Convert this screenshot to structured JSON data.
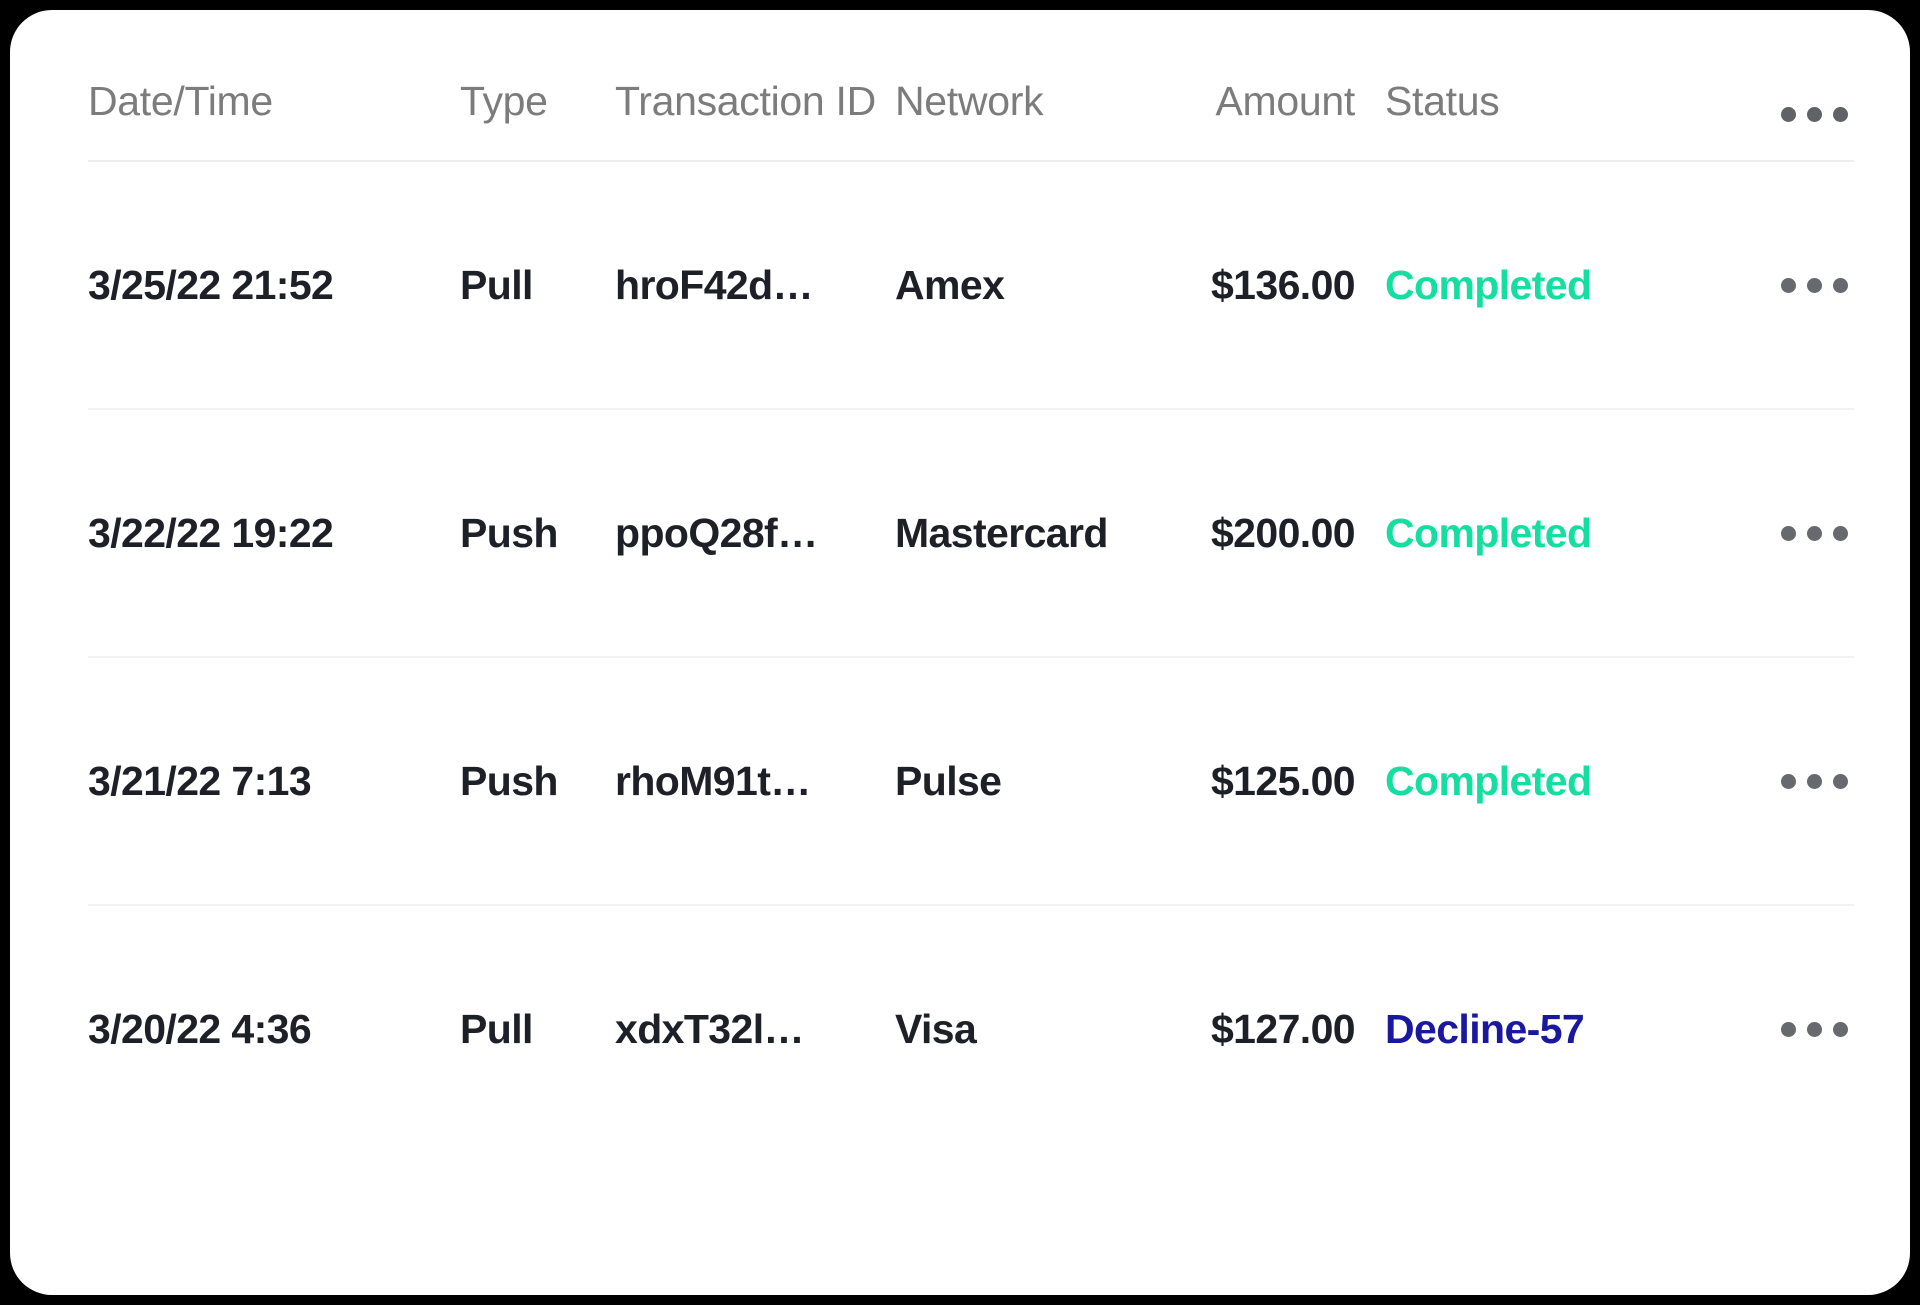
{
  "table": {
    "columns": [
      {
        "key": "datetime",
        "label": "Date/Time"
      },
      {
        "key": "type",
        "label": "Type"
      },
      {
        "key": "transaction_id",
        "label": "Transaction ID"
      },
      {
        "key": "network",
        "label": "Network"
      },
      {
        "key": "amount",
        "label": "Amount"
      },
      {
        "key": "status",
        "label": "Status"
      }
    ],
    "header_menu_icon": "ellipsis-icon",
    "row_menu_icon": "ellipsis-icon",
    "rows": [
      {
        "datetime": "3/25/22 21:52",
        "type": "Pull",
        "transaction_id": "hroF42d…",
        "network": "Amex",
        "amount": "$136.00",
        "status": "Completed",
        "status_state": "completed"
      },
      {
        "datetime": "3/22/22 19:22",
        "type": "Push",
        "transaction_id": "ppoQ28f…",
        "network": "Mastercard",
        "amount": "$200.00",
        "status": "Completed",
        "status_state": "completed"
      },
      {
        "datetime": "3/21/22 7:13",
        "type": "Push",
        "transaction_id": "rhoM91t…",
        "network": "Pulse",
        "amount": "$125.00",
        "status": "Completed",
        "status_state": "completed"
      },
      {
        "datetime": "3/20/22 4:36",
        "type": "Pull",
        "transaction_id": "xdxT32l…",
        "network": "Visa",
        "amount": "$127.00",
        "status": "Decline-57",
        "status_state": "declined"
      }
    ]
  },
  "colors": {
    "status_completed": "#14dfa1",
    "status_declined": "#1a189e",
    "header_text": "#7c7c7c",
    "body_text": "#1e2028",
    "divider": "#f1f2f4",
    "card_background": "#ffffff"
  }
}
